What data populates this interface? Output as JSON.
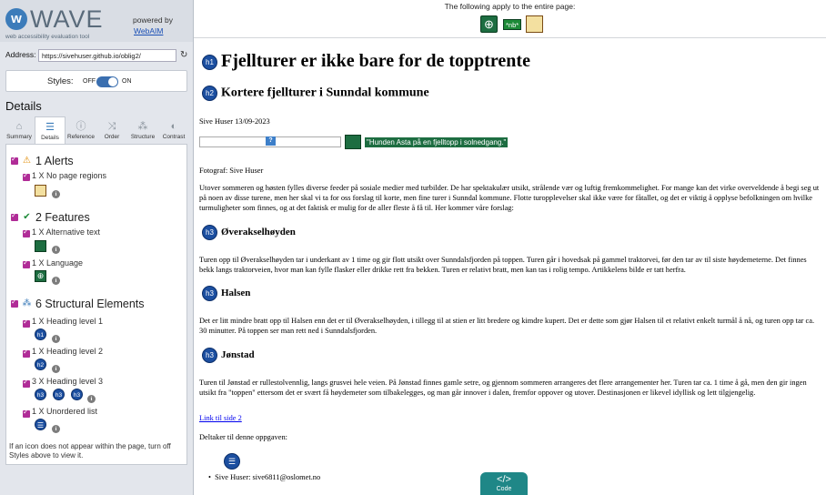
{
  "wave": {
    "name": "WAVE",
    "tagline": "web accessibility evaluation tool",
    "powered_by": "powered by",
    "webaim": "WebAIM",
    "address_label": "Address:",
    "address_value": "https://sivehuser.github.io/oblig2/",
    "styles_label": "Styles:",
    "styles_off": "OFF",
    "styles_on": "ON",
    "details_title": "Details",
    "tabs": [
      "Summary",
      "Details",
      "Reference",
      "Order",
      "Structure",
      "Contrast"
    ],
    "active_tab": "Details",
    "alerts": {
      "title": "1 Alerts",
      "items": [
        {
          "label": "1 X No page regions"
        }
      ]
    },
    "features": {
      "title": "2 Features",
      "items": [
        {
          "label": "1 X Alternative text"
        },
        {
          "label": "1 X Language"
        }
      ]
    },
    "structure": {
      "title": "6 Structural Elements",
      "items": [
        {
          "label": "1 X Heading level 1",
          "badges": [
            "h1"
          ]
        },
        {
          "label": "1 X Heading level 2",
          "badges": [
            "h2"
          ]
        },
        {
          "label": "3 X Heading level 3",
          "badges": [
            "h3",
            "h3",
            "h3"
          ]
        },
        {
          "label": "1 X Unordered list",
          "badges": [
            "ul"
          ]
        }
      ]
    },
    "note": "If an icon does not appear within the page, turn off Styles above to view it.",
    "colors": {
      "accent": "#3c7cba",
      "checkbox": "#b02c97",
      "feature": "#1d6d41",
      "heading": "#1c4fa0"
    }
  },
  "page": {
    "apply_text": "The following apply to the entire page:",
    "nb_badge": "*nb*",
    "h1_badge": "h1",
    "h1": "Fjellturer er ikke bare for de topptrente",
    "h2_badge": "h2",
    "h2": "Kortere fjellturer i Sunndal kommune",
    "byline": "Sive Huser 13/09-2023",
    "image_alt": "\"Hunden Asta på en fjelltopp i solnedgang.\"",
    "photo_credit": "Fotograf: Sive Huser",
    "intro": "Utover sommeren og høsten fylles diverse feeder på sosiale medier med turbilder. De har spektakulær utsikt, strålende vær og luftig fremkommelighet. For mange kan det virke overveldende å begi seg ut på noen av disse turene, men her skal vi ta for oss forslag til korte, men fine turer i Sunndal kommune. Flotte turopplevelser skal ikke være for fåtallet, og det er viktig å opplyse befolkningen om hvilke turmuligheter som finnes, og at det faktisk er mulig for de aller fleste å få til. Her kommer våre forslag:",
    "h3_badge": "h3",
    "sections": [
      {
        "title": "Øverakselhøyden",
        "text": "Turen opp til Øverakselhøyden tar i underkant av 1 time og gir flott utsikt over Sunndalsfjorden på toppen. Turen går i hovedsak på gammel traktorvei, før den tar av til siste høydemeterne. Det finnes bekk langs traktorveien, hvor man kan fylle flasker eller drikke rett fra bekken. Turen er relativt bratt, men kan tas i rolig tempo. Artikkelens bilde er tatt herfra."
      },
      {
        "title": "Halsen",
        "text": "Det er litt mindre bratt opp til Halsen enn det er til Øverakselhøyden, i tillegg til at stien er litt bredere og kimdre kupert. Det er dette som gjør Halsen til et relativt enkelt turmål å nå, og turen opp tar ca. 30 minutter. På toppen ser man rett ned i Sunndalsfjorden."
      },
      {
        "title": "Jønstad",
        "text": "Turen til Jønstad er rullestolvennlig, langs grusvei hele veien. På Jønstad finnes gamle setre, og gjennom sommeren arrangeres det flere arrangementer her. Turen tar ca. 1 time å gå, men den gir ingen utsikt fra \"toppen\" ettersom det er svært få høydemeter som tilbakelegges, og man går innover i dalen, fremfor oppover og utover. Destinasjonen er likevel idyllisk og lett tilgjengelig."
      }
    ],
    "link": "Link til side 2",
    "participants_label": "Deltaker til denne oppgaven:",
    "participant": "Sive Huser: sive6811@oslomet.no",
    "code_button": "Code"
  }
}
